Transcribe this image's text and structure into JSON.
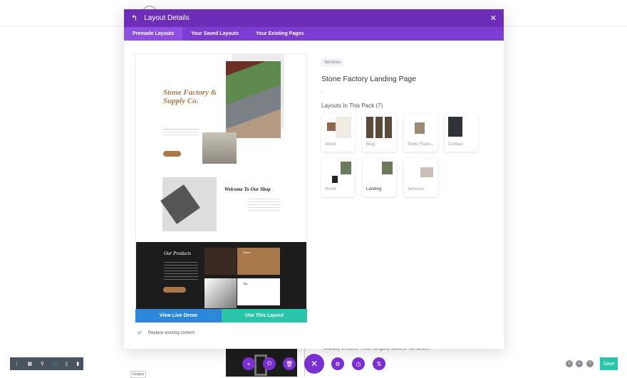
{
  "modal": {
    "title": "Layout Details",
    "back_icon": "back-arrow-icon",
    "close_icon": "close-icon",
    "tabs": [
      {
        "label": "Premade Layouts",
        "active": true
      },
      {
        "label": "Your Saved Layouts"
      },
      {
        "label": "Your Existing Pages"
      }
    ]
  },
  "preview": {
    "brand": "Stone Factory & Supply Co.",
    "welcome": "Welcome To Our Shop",
    "products": "Our Products",
    "stone": "Stone",
    "tile": "Tile"
  },
  "actions": {
    "demo": "View Live Demo",
    "use": "Use This Layout",
    "replace_label": "Replace existing content",
    "replace_checked": true
  },
  "details": {
    "category": "Services",
    "title": "Stone Factory Landing Page",
    "description": ".",
    "pack_heading": "Layouts In This Pack (7)",
    "layouts": [
      "About",
      "Blog",
      "Stone Facto...",
      "Contact",
      "Home",
      "Landing",
      "Services"
    ]
  },
  "background": {
    "text": "Curae, Donec velit neque, auctor sit amet",
    "images_label": "Images"
  },
  "toolbar": {
    "save": "Save"
  },
  "colors": {
    "header": "#6c2eb9",
    "tabs": "#7e3bd0",
    "demo": "#2b87da",
    "use": "#29c4a9",
    "save": "#29c4a9"
  }
}
